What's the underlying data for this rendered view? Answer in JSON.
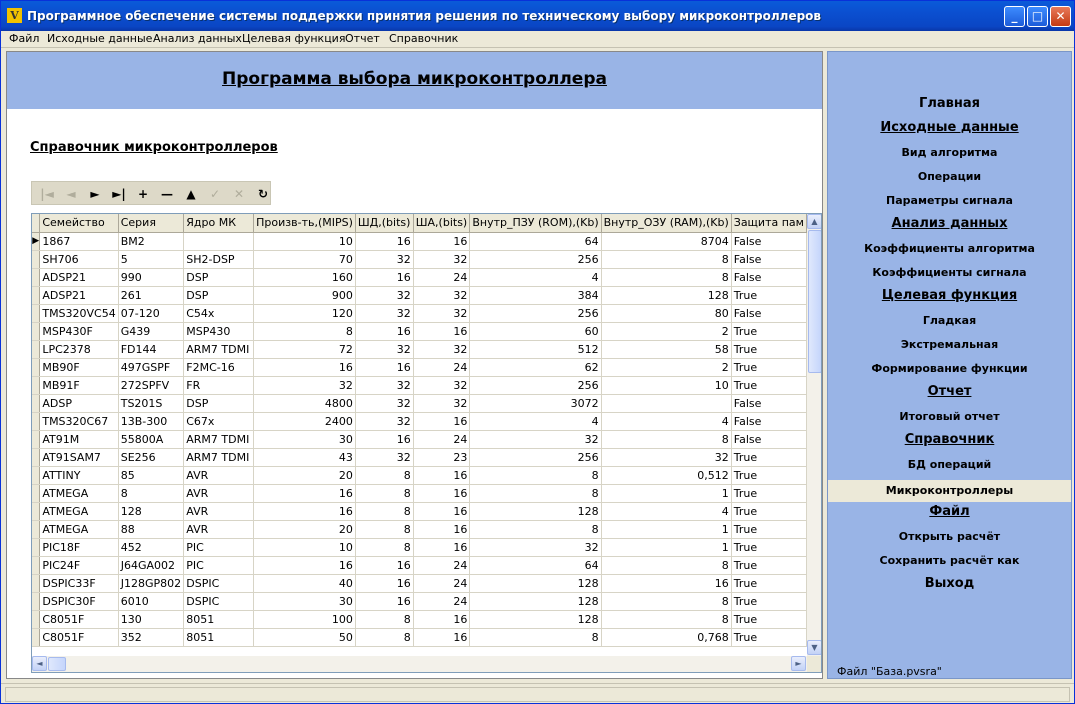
{
  "window": {
    "title": "Программное обеспечение системы поддержки принятия решения по техническому выбору микроконтроллеров",
    "icon_label": "V",
    "buttons": {
      "minimize": "_",
      "maximize": "□",
      "close": "✕"
    }
  },
  "menu": [
    "Файл",
    "Исходные данные",
    "Анализ данных",
    "Целевая функция",
    "Отчет",
    "Справочник"
  ],
  "banner_title": "Программа выбора микроконтроллера",
  "section_title": "Справочник микроконтроллеров",
  "navigator": [
    {
      "icon": "first-icon",
      "glyph": "|◄",
      "enabled": false
    },
    {
      "icon": "prior-icon",
      "glyph": "◄",
      "enabled": false
    },
    {
      "icon": "next-icon",
      "glyph": "►",
      "enabled": true
    },
    {
      "icon": "last-icon",
      "glyph": "►|",
      "enabled": true
    },
    {
      "icon": "insert-icon",
      "glyph": "+",
      "enabled": true
    },
    {
      "icon": "delete-icon",
      "glyph": "—",
      "enabled": true
    },
    {
      "icon": "edit-icon",
      "glyph": "▲",
      "enabled": true
    },
    {
      "icon": "post-icon",
      "glyph": "✓",
      "enabled": false
    },
    {
      "icon": "cancel-icon",
      "glyph": "✕",
      "enabled": false
    },
    {
      "icon": "refresh-icon",
      "glyph": "↻",
      "enabled": true
    }
  ],
  "table": {
    "columns": [
      "Семейство",
      "Серия",
      "Ядро МК",
      "Произв-ть,(MIPS)",
      "ШД,(bits)",
      "ША,(bits)",
      "Внутр_ПЗУ (ROM),(Kb)",
      "Внутр_ОЗУ (RAM),(Kb)",
      "Защита пам"
    ],
    "rows": [
      [
        "1867",
        "BM2",
        "",
        "10",
        "16",
        "16",
        "64",
        "8704",
        "False"
      ],
      [
        "SH706",
        "5",
        "SH2-DSP",
        "70",
        "32",
        "32",
        "256",
        "8",
        "False"
      ],
      [
        "ADSP21",
        "990",
        "DSP",
        "160",
        "16",
        "24",
        "4",
        "8",
        "False"
      ],
      [
        "ADSP21",
        "261",
        "DSP",
        "900",
        "32",
        "32",
        "384",
        "128",
        "True"
      ],
      [
        "TMS320VC54",
        "07-120",
        "C54x",
        "120",
        "32",
        "32",
        "256",
        "80",
        "False"
      ],
      [
        "MSP430F",
        "G439",
        "MSP430",
        "8",
        "16",
        "16",
        "60",
        "2",
        "True"
      ],
      [
        "LPC2378",
        "FD144",
        "ARM7 TDMI",
        "72",
        "32",
        "32",
        "512",
        "58",
        "True"
      ],
      [
        "MB90F",
        "497GSPF",
        "F2MC-16",
        "16",
        "16",
        "24",
        "62",
        "2",
        "True"
      ],
      [
        "MB91F",
        "272SPFV",
        "FR",
        "32",
        "32",
        "32",
        "256",
        "10",
        "True"
      ],
      [
        "ADSP",
        "TS201S",
        "DSP",
        "4800",
        "32",
        "32",
        "3072",
        "",
        "False"
      ],
      [
        "TMS320C67",
        "13B-300",
        "C67x",
        "2400",
        "32",
        "16",
        "4",
        "4",
        "False"
      ],
      [
        "AT91M",
        "55800A",
        "ARM7 TDMI",
        "30",
        "16",
        "24",
        "32",
        "8",
        "False"
      ],
      [
        "AT91SAM7",
        "SE256",
        "ARM7 TDMI",
        "43",
        "32",
        "23",
        "256",
        "32",
        "True"
      ],
      [
        "ATTINY",
        "85",
        "AVR",
        "20",
        "8",
        "16",
        "8",
        "0,512",
        "True"
      ],
      [
        "ATMEGA",
        "8",
        "AVR",
        "16",
        "8",
        "16",
        "8",
        "1",
        "True"
      ],
      [
        "ATMEGA",
        "128",
        "AVR",
        "16",
        "8",
        "16",
        "128",
        "4",
        "True"
      ],
      [
        "ATMEGA",
        "88",
        "AVR",
        "20",
        "8",
        "16",
        "8",
        "1",
        "True"
      ],
      [
        "PIC18F",
        "452",
        "PIC",
        "10",
        "8",
        "16",
        "32",
        "1",
        "True"
      ],
      [
        "PIC24F",
        "J64GA002",
        "PIC",
        "16",
        "16",
        "24",
        "64",
        "8",
        "True"
      ],
      [
        "DSPIC33F",
        "J128GP802",
        "DSPIC",
        "40",
        "16",
        "24",
        "128",
        "16",
        "True"
      ],
      [
        "DSPIC30F",
        "6010",
        "DSPIC",
        "30",
        "16",
        "24",
        "128",
        "8",
        "True"
      ],
      [
        "C8051F",
        "130",
        "8051",
        "100",
        "8",
        "16",
        "128",
        "8",
        "True"
      ],
      [
        "C8051F",
        "352",
        "8051",
        "50",
        "8",
        "16",
        "8",
        "0,768",
        "True"
      ]
    ]
  },
  "sidebar": {
    "items": [
      {
        "label": "Главная",
        "kind": "h"
      },
      {
        "label": "Исходные данные",
        "kind": "hu"
      },
      {
        "label": "Вид алгоритма",
        "kind": "s"
      },
      {
        "label": "Операции",
        "kind": "s"
      },
      {
        "label": "Параметры сигнала",
        "kind": "s"
      },
      {
        "label": "Анализ данных",
        "kind": "hu"
      },
      {
        "label": "Коэффициенты алгоритма",
        "kind": "s"
      },
      {
        "label": "Коэффициенты сигнала",
        "kind": "s"
      },
      {
        "label": "Целевая функция",
        "kind": "hu"
      },
      {
        "label": "Гладкая",
        "kind": "s"
      },
      {
        "label": "Экстремальная",
        "kind": "s"
      },
      {
        "label": "Формирование функции",
        "kind": "s"
      },
      {
        "label": "Отчет",
        "kind": "hu"
      },
      {
        "label": "Итоговый отчет",
        "kind": "s"
      },
      {
        "label": "Справочник",
        "kind": "hu"
      },
      {
        "label": "БД операций",
        "kind": "s"
      },
      {
        "label": "Микроконтроллеры",
        "kind": "s",
        "selected": true
      },
      {
        "label": "Файл",
        "kind": "hu"
      },
      {
        "label": "Открыть расчёт",
        "kind": "s"
      },
      {
        "label": "Сохранить расчёт как",
        "kind": "s"
      },
      {
        "label": "Выход",
        "kind": "h"
      }
    ],
    "file_label": "Файл \"База.pvsra\""
  }
}
